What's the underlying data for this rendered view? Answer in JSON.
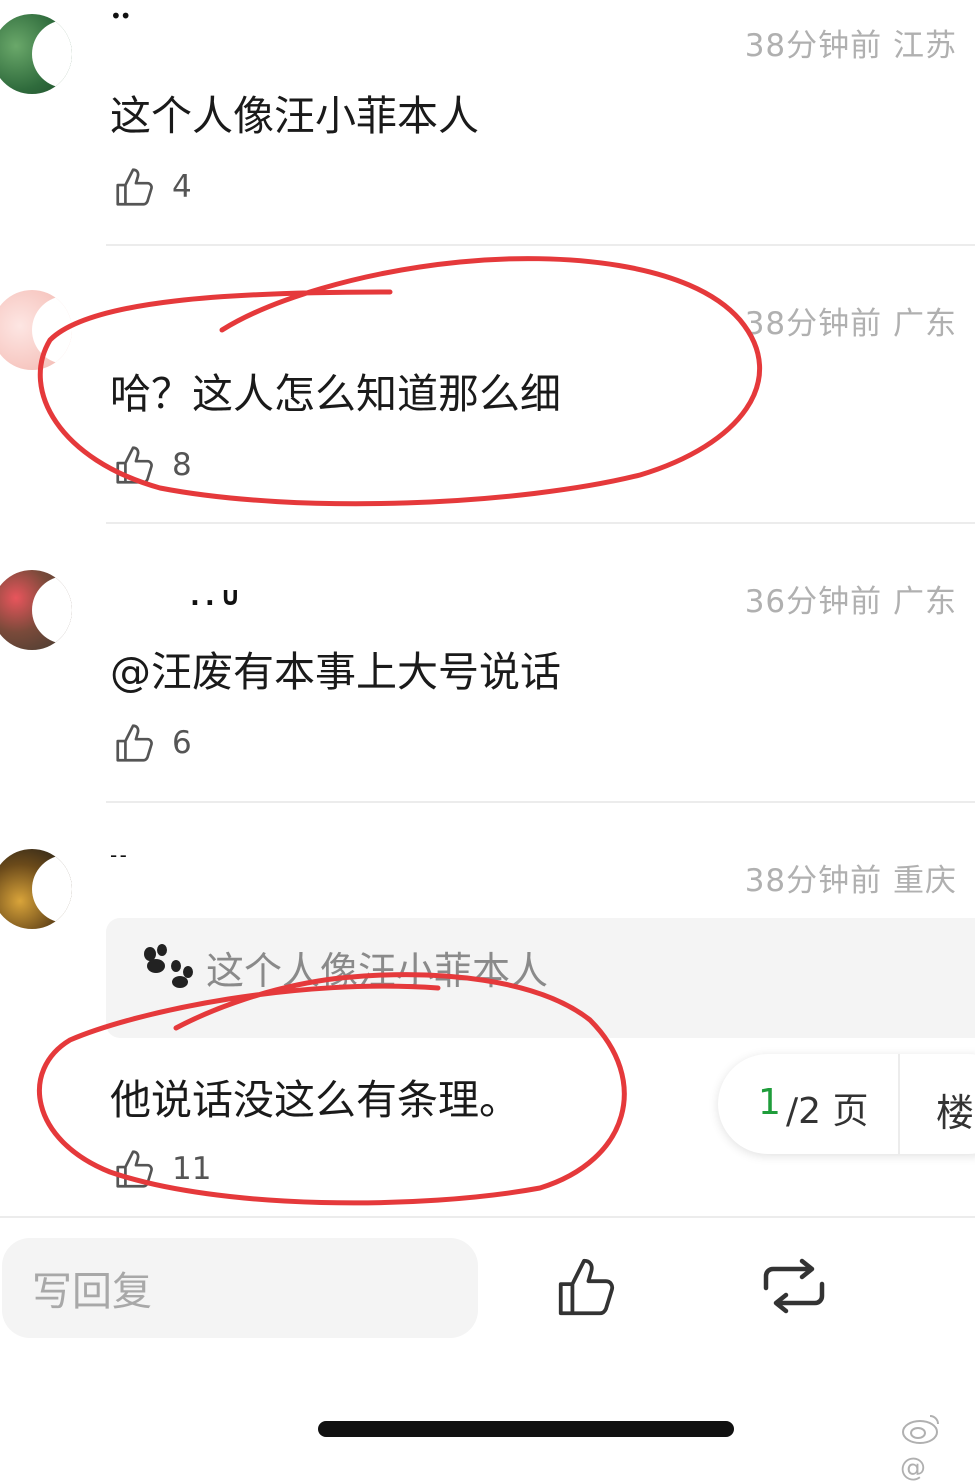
{
  "comments": [
    {
      "username": "••",
      "time": "38分钟前",
      "region": "江苏",
      "text": "这个人像汪小菲本人",
      "likes": "4"
    },
    {
      "username": "",
      "time": "38分钟前",
      "region": "广东",
      "text": "哈？这人怎么知道那么细",
      "likes": "8"
    },
    {
      "username": ". . ∪",
      "time": "36分钟前",
      "region": "广东",
      "text": "@汪废有本事上大号说话",
      "likes": "6"
    },
    {
      "username": "- -",
      "time": "38分钟前",
      "region": "重庆",
      "quote": "这个人像汪小菲本人",
      "text": "他说话没这么有条理。",
      "likes": "11"
    }
  ],
  "pager": {
    "current": "1",
    "total": "/2 页",
    "floor_label": "楼"
  },
  "bottom_bar": {
    "reply_placeholder": "写回复"
  },
  "watermark": "@",
  "colors": {
    "annotation_red": "#e5393b",
    "accent_green": "#1f9d3b",
    "meta_gray": "#b0b0b0"
  },
  "icons": [
    "thumbs-up-icon",
    "paw-icon",
    "repost-icon",
    "weibo-logo-icon"
  ]
}
